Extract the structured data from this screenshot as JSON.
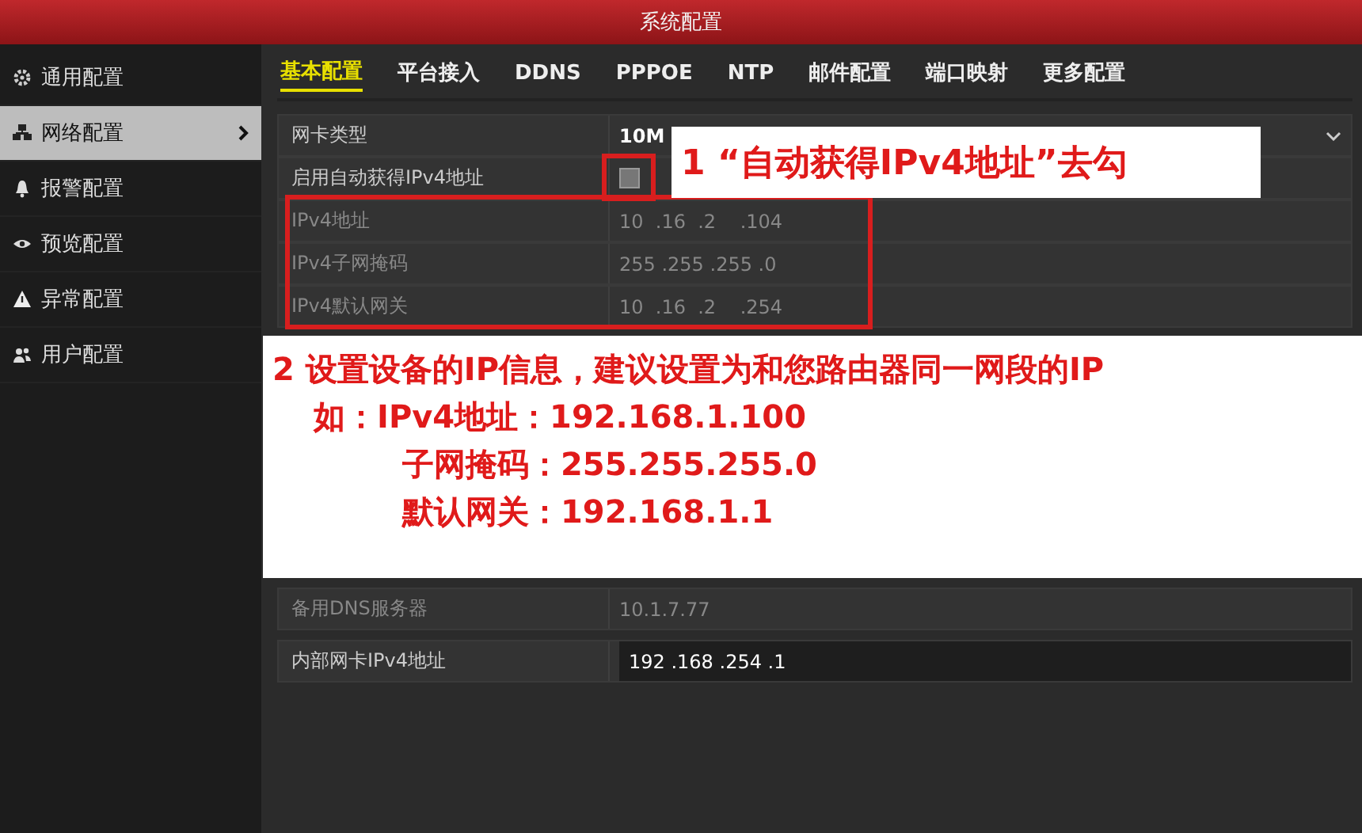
{
  "window": {
    "title": "系统配置"
  },
  "sidebar": {
    "items": [
      {
        "label": "通用配置",
        "selected": false
      },
      {
        "label": "网络配置",
        "selected": true
      },
      {
        "label": "报警配置",
        "selected": false
      },
      {
        "label": "预览配置",
        "selected": false
      },
      {
        "label": "异常配置",
        "selected": false
      },
      {
        "label": "用户配置",
        "selected": false
      }
    ]
  },
  "tabs": [
    {
      "label": "基本配置",
      "selected": true
    },
    {
      "label": "平台接入",
      "selected": false
    },
    {
      "label": "DDNS",
      "selected": false
    },
    {
      "label": "PPPOE",
      "selected": false
    },
    {
      "label": "NTP",
      "selected": false
    },
    {
      "label": "邮件配置",
      "selected": false
    },
    {
      "label": "端口映射",
      "selected": false
    },
    {
      "label": "更多配置",
      "selected": false
    }
  ],
  "form": {
    "rows": [
      {
        "kind": "select",
        "label": "网卡类型",
        "value": "10M",
        "disabled": false
      },
      {
        "kind": "checkbox",
        "label": "启用自动获得IPv4地址",
        "checked": false,
        "disabled": false
      },
      {
        "kind": "text",
        "label": "IPv4地址",
        "value": "10  .16  .2    .104",
        "disabled": true
      },
      {
        "kind": "text",
        "label": "IPv4子网掩码",
        "value": "255 .255 .255 .0",
        "disabled": true
      },
      {
        "kind": "text",
        "label": "IPv4默认网关",
        "value": "10  .16  .2    .254",
        "disabled": true
      }
    ],
    "rows_below": [
      {
        "kind": "text",
        "label": "备用DNS服务器",
        "value": "10.1.7.77",
        "disabled": true
      },
      {
        "kind": "field",
        "label": "内部网卡IPv4地址",
        "value": "192 .168 .254 .1",
        "disabled": false
      }
    ]
  },
  "annotations": [
    {
      "lines": [
        "1 “自动获得IPv4地址”去勾"
      ]
    },
    {
      "lines": [
        "2 设置设备的IP信息，建议设置为和您路由器同一网段的IP",
        "如：IPv4地址：192.168.1.100",
        "子网掩码：255.255.255.0",
        "默认网关：192.168.1.1"
      ]
    }
  ]
}
